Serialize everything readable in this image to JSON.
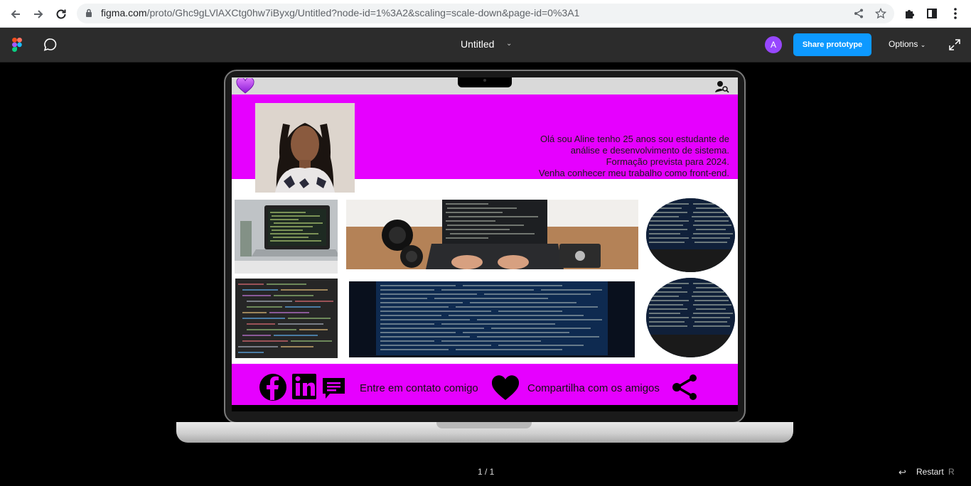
{
  "browser": {
    "url_host": "figma.com",
    "url_path": "/proto/Ghc9gLVlAXCtg0hw7iByxg/Untitled?node-id=1%3A2&scaling=scale-down&page-id=0%3A1",
    "back_icon": "arrow-left-icon",
    "forward_icon": "arrow-right-icon",
    "reload_icon": "reload-icon"
  },
  "toolbar": {
    "file_title": "Untitled",
    "avatar_initial": "A",
    "share_label": "Share prototype",
    "options_label": "Options",
    "accent": "#0d99ff",
    "avatar_color": "#9747ff"
  },
  "site": {
    "hero_color": "#e600ff",
    "hero_text": [
      "Olá sou Aline tenho 25 anos sou estudante de",
      "análise e desenvolvimento de sistema.",
      "Formação prevista para 2024.",
      "Venha conhecer meu trabalho como front-end."
    ],
    "footer": {
      "contact_label": "Entre em contato comigo",
      "share_label": "Compartilha com os amigos"
    }
  },
  "viewer": {
    "page_count": "1 / 1",
    "restart_label": "Restart",
    "restart_key": "R"
  }
}
